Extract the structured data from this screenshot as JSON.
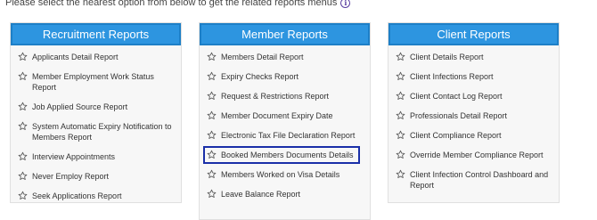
{
  "intro": {
    "text": "Please select the nearest option from below to get the related reports menus"
  },
  "icon": "info-icon",
  "colors": {
    "header": "#2d95e0",
    "highlight": "#1a2fa8"
  },
  "cards": [
    {
      "title": "Recruitment Reports",
      "items": [
        "Applicants Detail Report",
        "Member Employment Work Status Report",
        "Job Applied Source Report",
        "System Automatic Expiry Notification to Members Report",
        "Interview Appointments",
        "Never Employ Report",
        "Seek Applications Report"
      ]
    },
    {
      "title": "Member Reports",
      "items": [
        "Members Detail Report",
        "Expiry Checks Report",
        "Request & Restrictions Report",
        "Member Document Expiry Date",
        "Electronic Tax File Declaration Report",
        "Booked Members Documents Details",
        "Members Worked on Visa Details",
        "Leave Balance Report"
      ]
    },
    {
      "title": "Client Reports",
      "items": [
        "Client Details Report",
        "Client Infections Report",
        "Client Contact Log Report",
        "Professionals Detail Report",
        "Client Compliance Report",
        "Override Member Compliance Report",
        "Client Infection Control Dashboard and Report"
      ]
    }
  ]
}
